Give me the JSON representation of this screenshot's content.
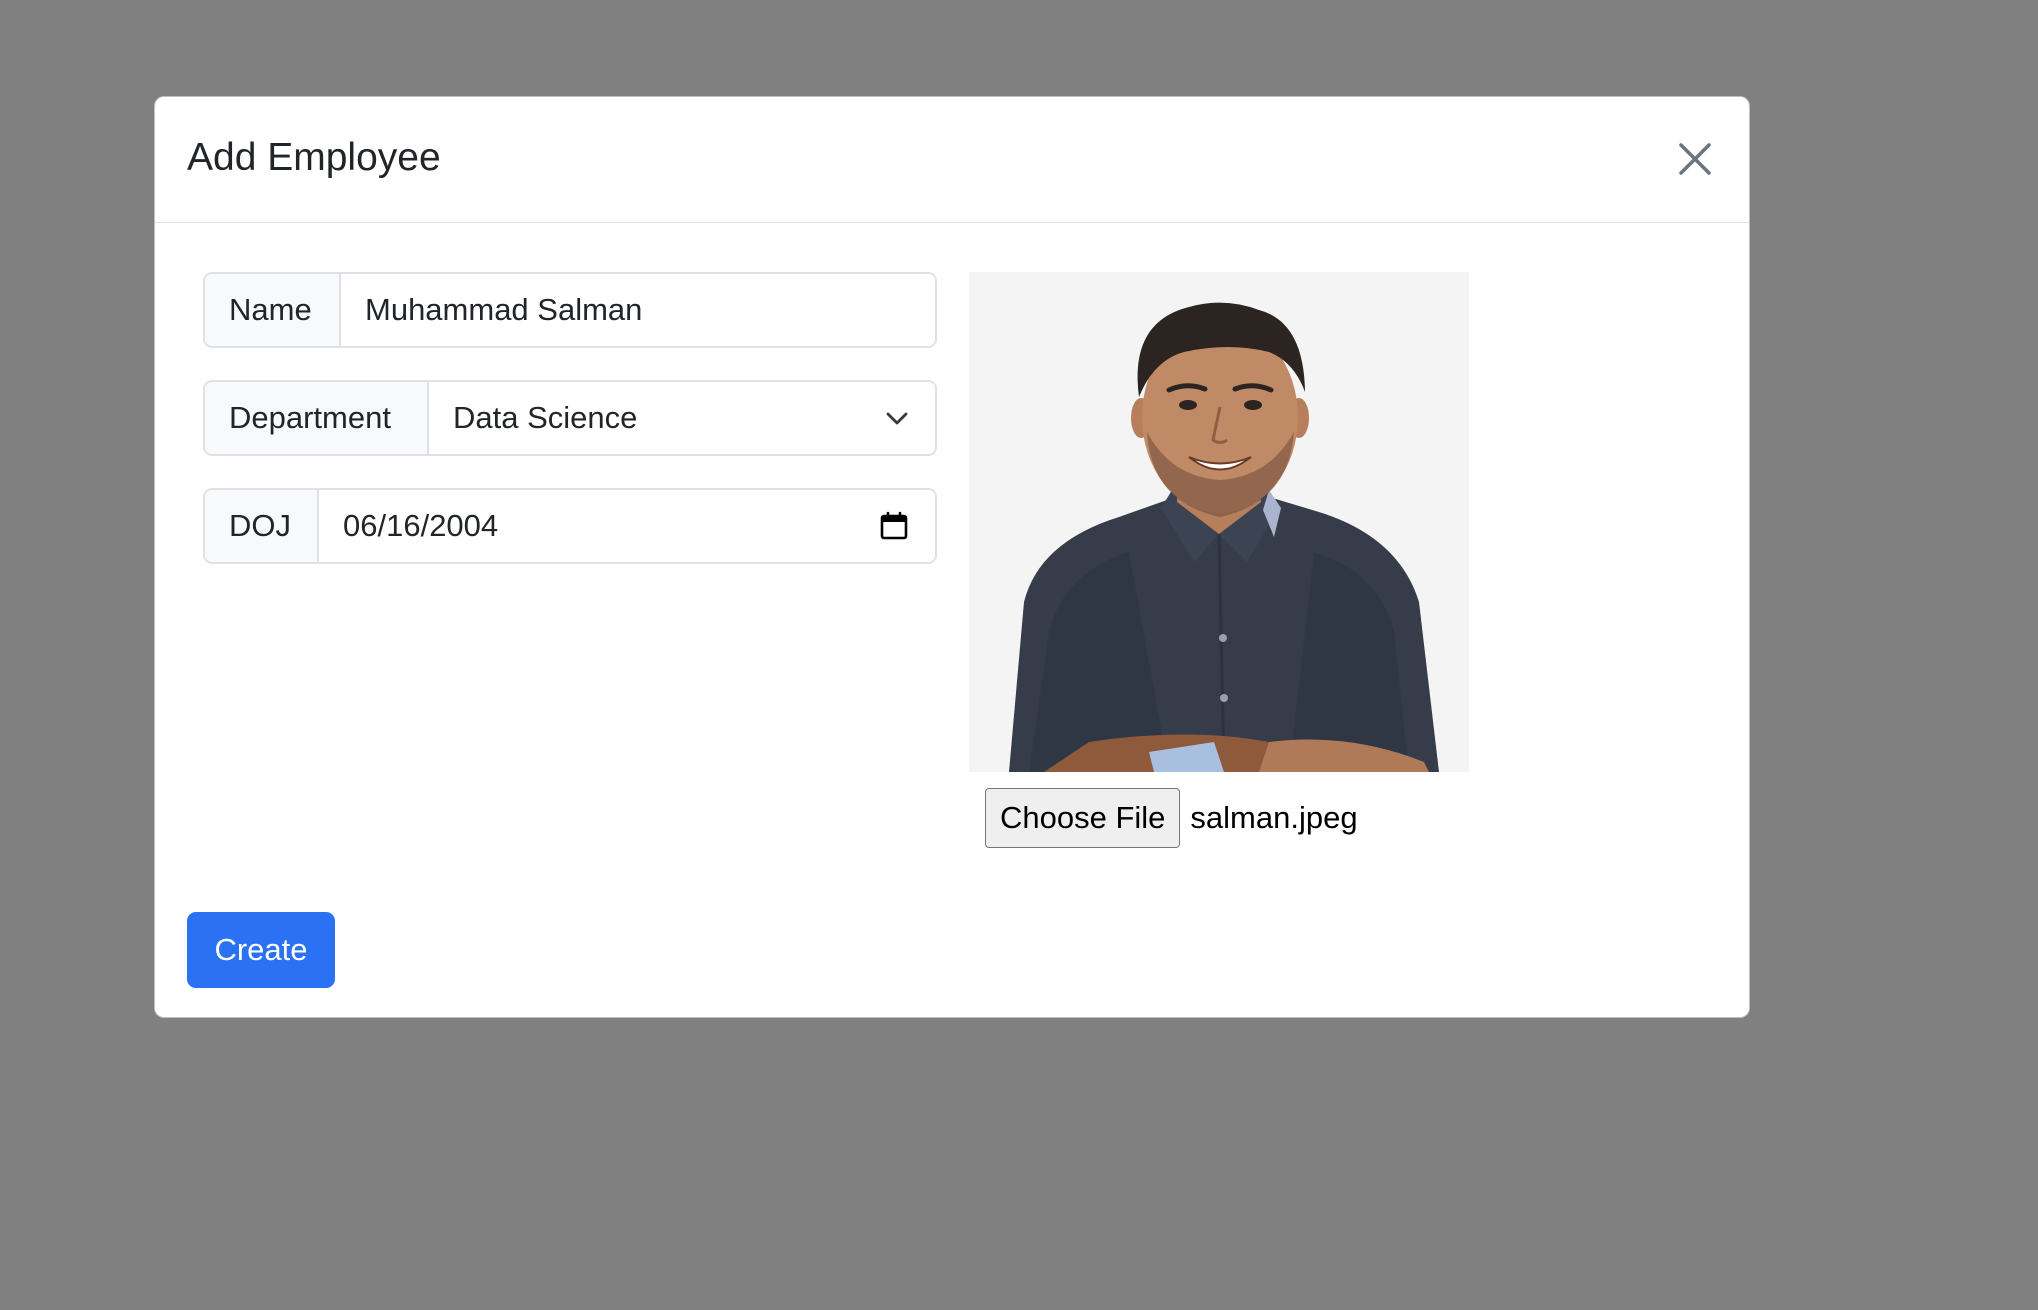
{
  "modal": {
    "title": "Add Employee",
    "close_icon": "close-icon"
  },
  "form": {
    "name": {
      "label": "Name",
      "value": "Muhammad Salman"
    },
    "department": {
      "label": "Department",
      "selected": "Data Science",
      "icon": "chevron-down-icon"
    },
    "doj": {
      "label": "DOJ",
      "value": "06/16/2004",
      "icon": "calendar-icon"
    }
  },
  "photo": {
    "icon": "employee-photo"
  },
  "file_input": {
    "button_label": "Choose File",
    "file_name": "salman.jpeg"
  },
  "actions": {
    "create_label": "Create"
  },
  "colors": {
    "overlay": "#808080",
    "primary": "#2a72f3",
    "border": "#dee2e6",
    "label_bg": "#f8f9fa"
  }
}
